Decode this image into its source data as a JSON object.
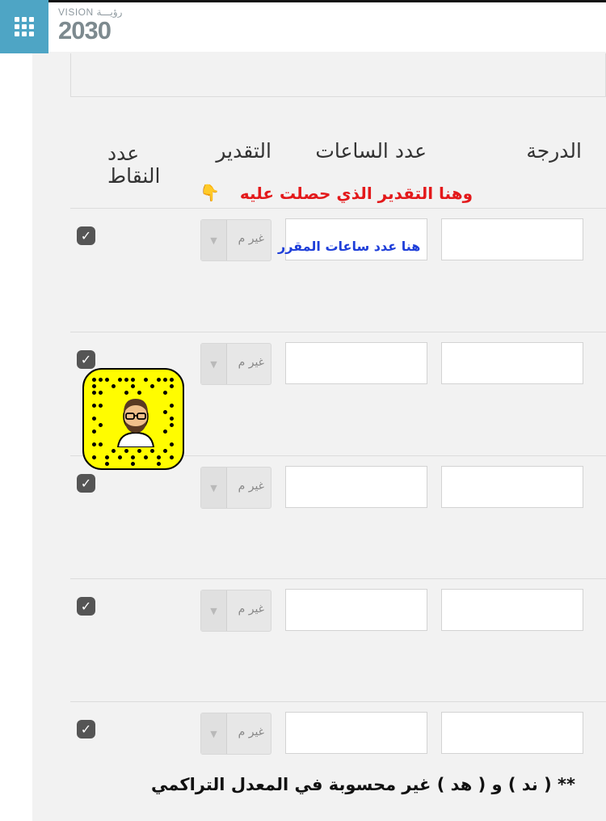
{
  "logo": {
    "small": "VISION رؤيـــة",
    "big": "2030"
  },
  "headers": {
    "grade": "الدرجة",
    "hours": "عدد الساعات",
    "rating": "التقدير",
    "points": "عدد النقاط"
  },
  "annotations": {
    "rating_note": "وهنا التقدير الذي حصلت عليه",
    "hours_note": "هنا عدد ساعات المقرر",
    "footer": "** ( ند ) و ( هد ) غير محسوبة في المعدل التراكمي"
  },
  "rows": [
    {
      "checked": true,
      "rating": "غير م",
      "hours": "",
      "grade": ""
    },
    {
      "checked": true,
      "rating": "غير م",
      "hours": "",
      "grade": ""
    },
    {
      "checked": true,
      "rating": "غير م",
      "hours": "",
      "grade": ""
    },
    {
      "checked": true,
      "rating": "غير م",
      "hours": "",
      "grade": ""
    },
    {
      "checked": true,
      "rating": "غير م",
      "hours": "",
      "grade": ""
    }
  ],
  "colors": {
    "menu_button": "#4ea5c5",
    "red_note": "#e3191b",
    "blue_note": "#1f3fd9",
    "snapcode": "#fffc00"
  },
  "icons": {
    "menu": "grid-icon",
    "checkbox": "checkmark-icon",
    "select_arrow": "caret-down-icon",
    "pointer": "pointing-hand-icon"
  }
}
